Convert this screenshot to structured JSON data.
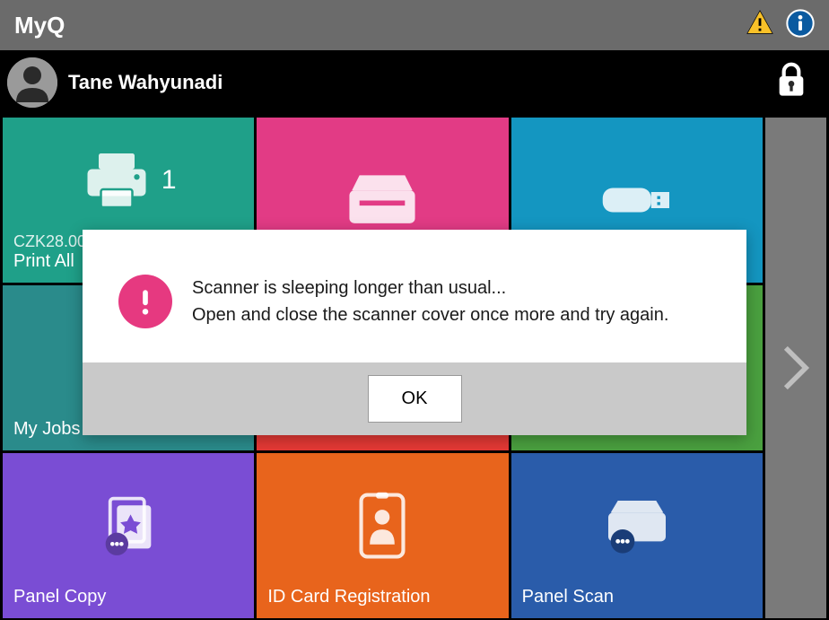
{
  "topbar": {
    "title": "MyQ"
  },
  "user": {
    "name": "Tane Wahyunadi"
  },
  "tiles": {
    "print_all": {
      "label": "Print All",
      "cost": "CZK28.00",
      "count": "1"
    },
    "my_jobs": {
      "label": "My Jobs"
    },
    "panel_copy": {
      "label": "Panel Copy"
    },
    "id_card": {
      "label": "ID Card Registration"
    },
    "panel_scan": {
      "label": "Panel Scan"
    }
  },
  "modal": {
    "line1": "Scanner is sleeping longer than usual...",
    "line2": "Open and close the scanner cover once more and try again.",
    "ok": "OK"
  }
}
